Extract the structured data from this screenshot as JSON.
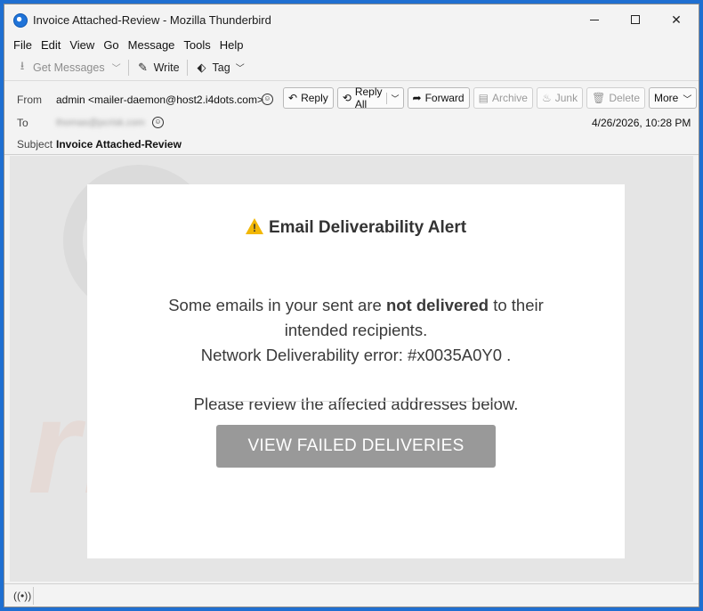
{
  "window": {
    "title": "Invoice Attached-Review - Mozilla Thunderbird"
  },
  "menu": [
    "File",
    "Edit",
    "View",
    "Go",
    "Message",
    "Tools",
    "Help"
  ],
  "toolbar": {
    "get_messages": "Get Messages",
    "write": "Write",
    "tag": "Tag"
  },
  "header": {
    "from_label": "From",
    "from_value": "admin <mailer-daemon@host2.i4dots.com>",
    "to_label": "To",
    "to_value": "thomas@pcrisk.com",
    "subject_label": "Subject",
    "subject_value": "Invoice Attached-Review",
    "date": "4/26/2026, 10:28 PM",
    "buttons": {
      "reply": "Reply",
      "reply_all": "Reply All",
      "forward": "Forward",
      "archive": "Archive",
      "junk": "Junk",
      "delete": "Delete",
      "more": "More"
    }
  },
  "message": {
    "title": "Email Deliverability Alert",
    "p1_a": "Some emails in your sent are ",
    "p1_bold": "not delivered",
    "p1_b": " to their",
    "p1_line2": "intended recipients.",
    "p2": "Network Deliverability error: #x0035A0Y0 .",
    "p3": "Please review the affected addresses below.",
    "cta": "VIEW FAILED DELIVERIES"
  },
  "watermark": "risk.com",
  "colors": {
    "titlebar_bg": "#f3f3f3",
    "body_bg": "#e5e5e5",
    "cta_bg": "#999999",
    "warning": "#f2b705"
  }
}
